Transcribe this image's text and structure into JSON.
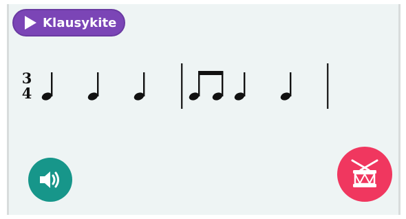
{
  "header": {
    "play_button_label": "Klausykite"
  },
  "notation": {
    "time_signature": {
      "numerator": "3",
      "denominator": "4"
    },
    "measures": [
      {
        "notes": [
          "quarter",
          "quarter",
          "quarter"
        ]
      },
      {
        "notes": [
          "eighth-pair",
          "quarter",
          "quarter"
        ]
      }
    ]
  },
  "controls": {
    "sound_icon": "speaker-icon",
    "drum_icon": "drum-icon"
  },
  "colors": {
    "play_button": "#7b45b6",
    "sound_button": "#17968a",
    "drum_button": "#f0375f",
    "card_background": "#eef4f4"
  }
}
